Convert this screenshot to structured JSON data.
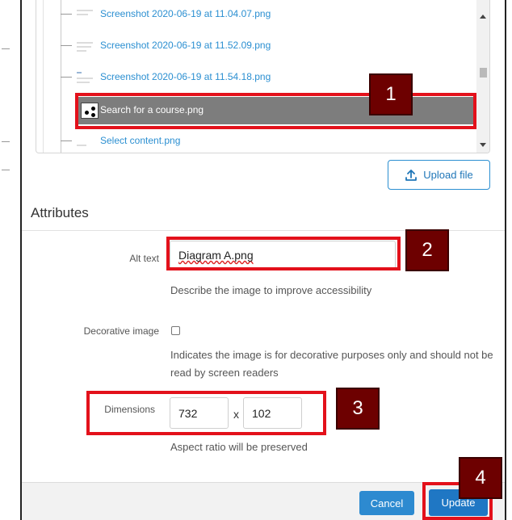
{
  "file_list": {
    "items": [
      {
        "name": "Screenshot 2020-06-19 at 11.04.07.png",
        "selected": false
      },
      {
        "name": "Screenshot 2020-06-19 at 11.52.09.png",
        "selected": false
      },
      {
        "name": "Screenshot 2020-06-19 at 11.54.18.png",
        "selected": false
      },
      {
        "name": "Search for a course.png",
        "selected": true
      },
      {
        "name": "Select content.png",
        "selected": false
      }
    ]
  },
  "upload": {
    "label": "Upload file",
    "icon": "upload-icon"
  },
  "attributes": {
    "title": "Attributes",
    "alt_text": {
      "label": "Alt text",
      "value": "Diagram A.png",
      "help": "Describe the image to improve accessibility"
    },
    "decorative": {
      "label": "Decorative image",
      "checked": false,
      "help": "Indicates the image is for decorative purposes only and should not be read by screen readers"
    },
    "dimensions": {
      "label": "Dimensions",
      "width": "732",
      "separator": "x",
      "height": "102",
      "help": "Aspect ratio will be preserved"
    }
  },
  "footer": {
    "cancel_label": "Cancel",
    "update_label": "Update"
  },
  "annotations": {
    "n1": "1",
    "n2": "2",
    "n3": "3",
    "n4": "4"
  },
  "colors": {
    "accent": "#2b8fd1",
    "annotation_red": "#e3111b",
    "annotation_badge": "#6d0000",
    "selected_row": "#7d7d7d"
  }
}
